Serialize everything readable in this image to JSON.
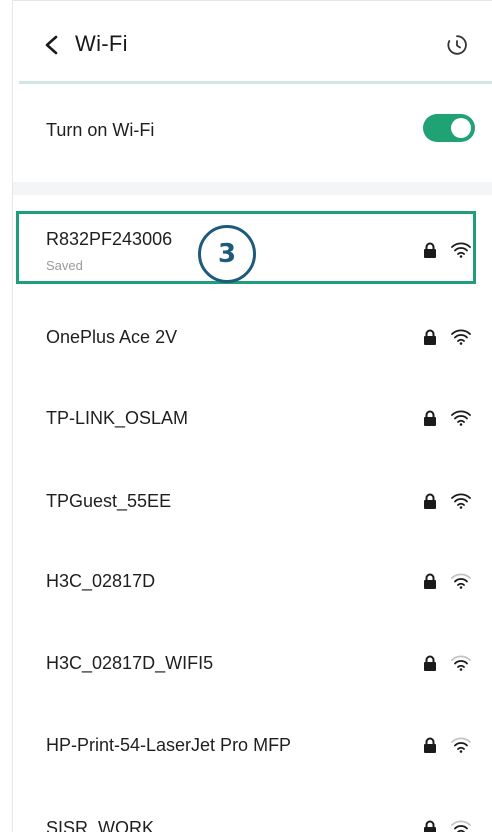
{
  "header": {
    "back_icon": "chevron-left-icon",
    "title": "Wi-Fi",
    "history_icon": "history-icon"
  },
  "toggle": {
    "label": "Turn on Wi-Fi",
    "state": "on",
    "color": "#1fa374"
  },
  "networks": [
    {
      "name": "R832PF243006",
      "status": "Saved",
      "secured": true,
      "signal": "full"
    },
    {
      "name": "OnePlus Ace 2V",
      "status": "",
      "secured": true,
      "signal": "full"
    },
    {
      "name": "TP-LINK_OSLAM",
      "status": "",
      "secured": true,
      "signal": "full"
    },
    {
      "name": "TPGuest_55EE",
      "status": "",
      "secured": true,
      "signal": "full"
    },
    {
      "name": "H3C_02817D",
      "status": "",
      "secured": true,
      "signal": "medium"
    },
    {
      "name": "H3C_02817D_WIFI5",
      "status": "",
      "secured": true,
      "signal": "medium"
    },
    {
      "name": "HP-Print-54-LaserJet Pro MFP",
      "status": "",
      "secured": true,
      "signal": "medium"
    },
    {
      "name": "SISR_WORK",
      "status": "",
      "secured": true,
      "signal": "medium"
    }
  ],
  "annotation": {
    "step": "3",
    "highlight_color": "#1f9e7e",
    "badge_color": "#1e5a7a"
  }
}
